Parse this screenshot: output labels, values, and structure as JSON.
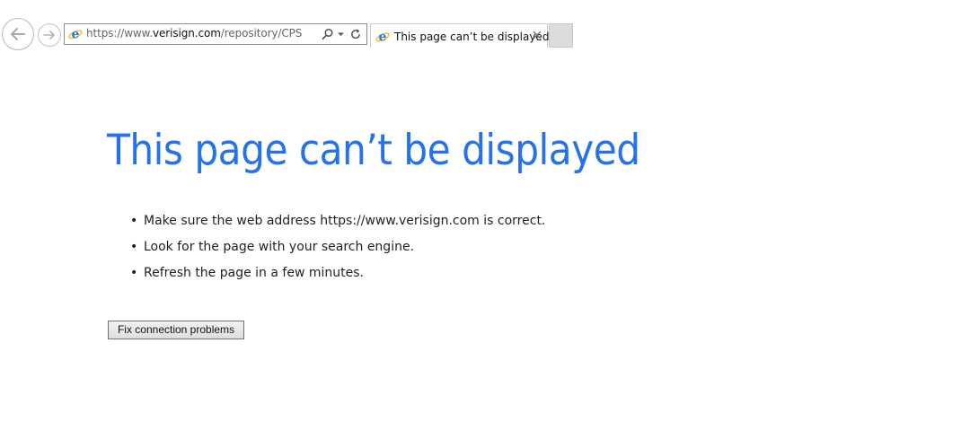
{
  "browser": {
    "address_bar": {
      "url_prefix": "https://www.",
      "url_host": "verisign.com",
      "url_path": "/repository/CPS"
    },
    "tab": {
      "title": "This page can’t be displayed",
      "close_glyph": "✕"
    },
    "icons": {
      "back": "back-arrow-icon",
      "forward": "forward-arrow-icon",
      "site": "internet-explorer-icon",
      "search": "search-icon",
      "dropdown": "dropdown-arrow-icon",
      "refresh": "refresh-icon",
      "close": "close-icon"
    }
  },
  "page": {
    "title": "This page can’t be displayed",
    "suggestions": [
      "Make sure the web address https://www.verisign.com is correct.",
      "Look for the page with your search engine.",
      "Refresh the page in a few minutes."
    ],
    "fix_button_label": "Fix connection problems"
  },
  "colors": {
    "title_blue": "#2672ec",
    "ie_blue": "#1f7fd6",
    "ie_ring": "#f2b728"
  }
}
